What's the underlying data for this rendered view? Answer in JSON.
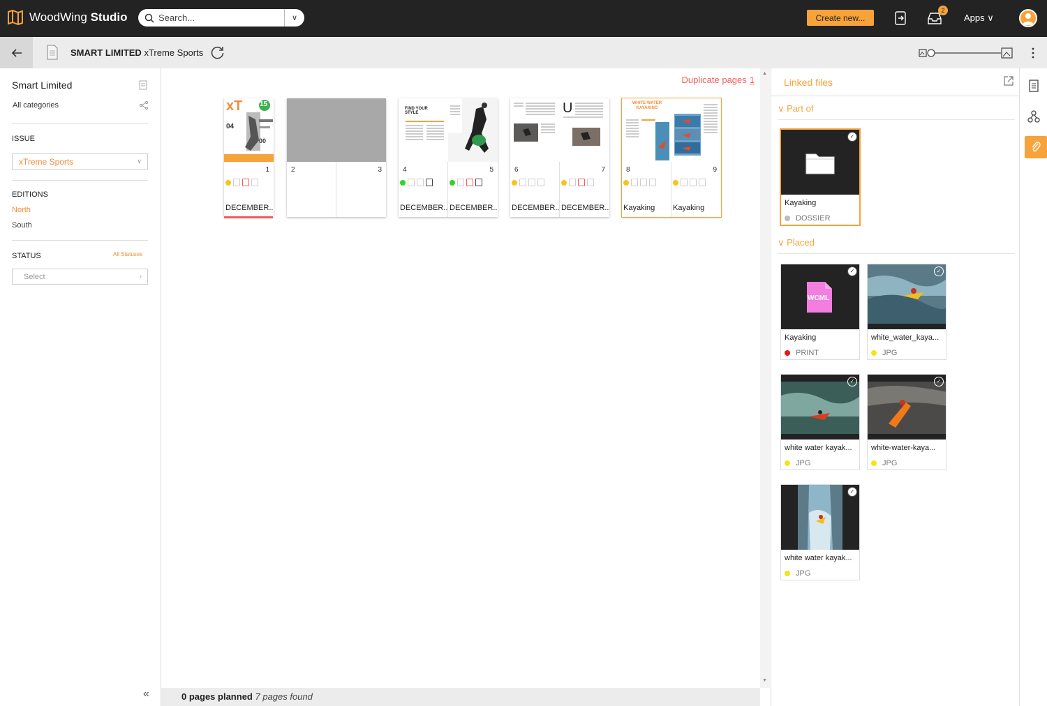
{
  "topbar": {
    "brand_light": "WoodWing",
    "brand_bold": "Studio",
    "search_placeholder": "Search...",
    "create_label": "Create new...",
    "inbox_badge": "2",
    "apps_label": "Apps ∨"
  },
  "subbar": {
    "brand": "SMART LIMITED",
    "issue": "xTreme Sports"
  },
  "sidebar": {
    "title": "Smart Limited",
    "categories": "All categories",
    "issue_label": "ISSUE",
    "issue_value": "xTreme Sports",
    "editions_label": "EDITIONS",
    "editions": [
      "North",
      "South"
    ],
    "status_label": "STATUS",
    "all_statuses": "All Statuses",
    "status_placeholder": "Select"
  },
  "main": {
    "duplicate_label": "Duplicate pages",
    "duplicate_count": "1",
    "pages_planned": "0 pages planned",
    "pages_found": "7 pages found",
    "spreads": [
      {
        "pages": [
          {
            "num": "1",
            "label": "DECEMBER...",
            "status": "#f5c518"
          }
        ]
      },
      {
        "pages": [
          {
            "num": "2",
            "label": ""
          },
          {
            "num": "3",
            "label": ""
          }
        ]
      },
      {
        "pages": [
          {
            "num": "4",
            "label": "DECEMBER...",
            "status": "#34d126"
          },
          {
            "num": "5",
            "label": "DECEMBER...",
            "status": "#34d126"
          }
        ]
      },
      {
        "pages": [
          {
            "num": "6",
            "label": "DECEMBER...",
            "status": "#f5c518"
          },
          {
            "num": "7",
            "label": "DECEMBER...",
            "status": "#f5c518"
          }
        ]
      },
      {
        "pages": [
          {
            "num": "8",
            "label": "Kayaking",
            "status": "#f5c518"
          },
          {
            "num": "9",
            "label": "Kayaking",
            "status": "#f5c518"
          }
        ]
      }
    ],
    "cover_text": {
      "logo": "xT",
      "badge": "15",
      "number": "04",
      "side": "00"
    },
    "page4_text": "FIND YOUR STYLE",
    "page7_text": "U",
    "page8_text": "WHITE WATER KAYAKING"
  },
  "rpanel": {
    "title": "Linked files",
    "part_of_label": "Part of",
    "placed_label": "Placed",
    "part_of": [
      {
        "name": "Kayaking",
        "type": "DOSSIER",
        "dot": "#bbbbbb"
      }
    ],
    "placed": [
      {
        "name": "Kayaking",
        "type": "PRINT",
        "dot": "#e81818",
        "thumb_label": "WCML"
      },
      {
        "name": "white_water_kaya...",
        "type": "JPG",
        "dot": "#f5e31a"
      },
      {
        "name": "white water kayak...",
        "type": "JPG",
        "dot": "#f5e31a"
      },
      {
        "name": "white-water-kaya...",
        "type": "JPG",
        "dot": "#f5e31a"
      },
      {
        "name": "white water kayak...",
        "type": "JPG",
        "dot": "#f5e31a"
      }
    ]
  },
  "colors": {
    "accent": "#f7a33a",
    "alert": "#f25d5d",
    "dark": "#232323"
  }
}
